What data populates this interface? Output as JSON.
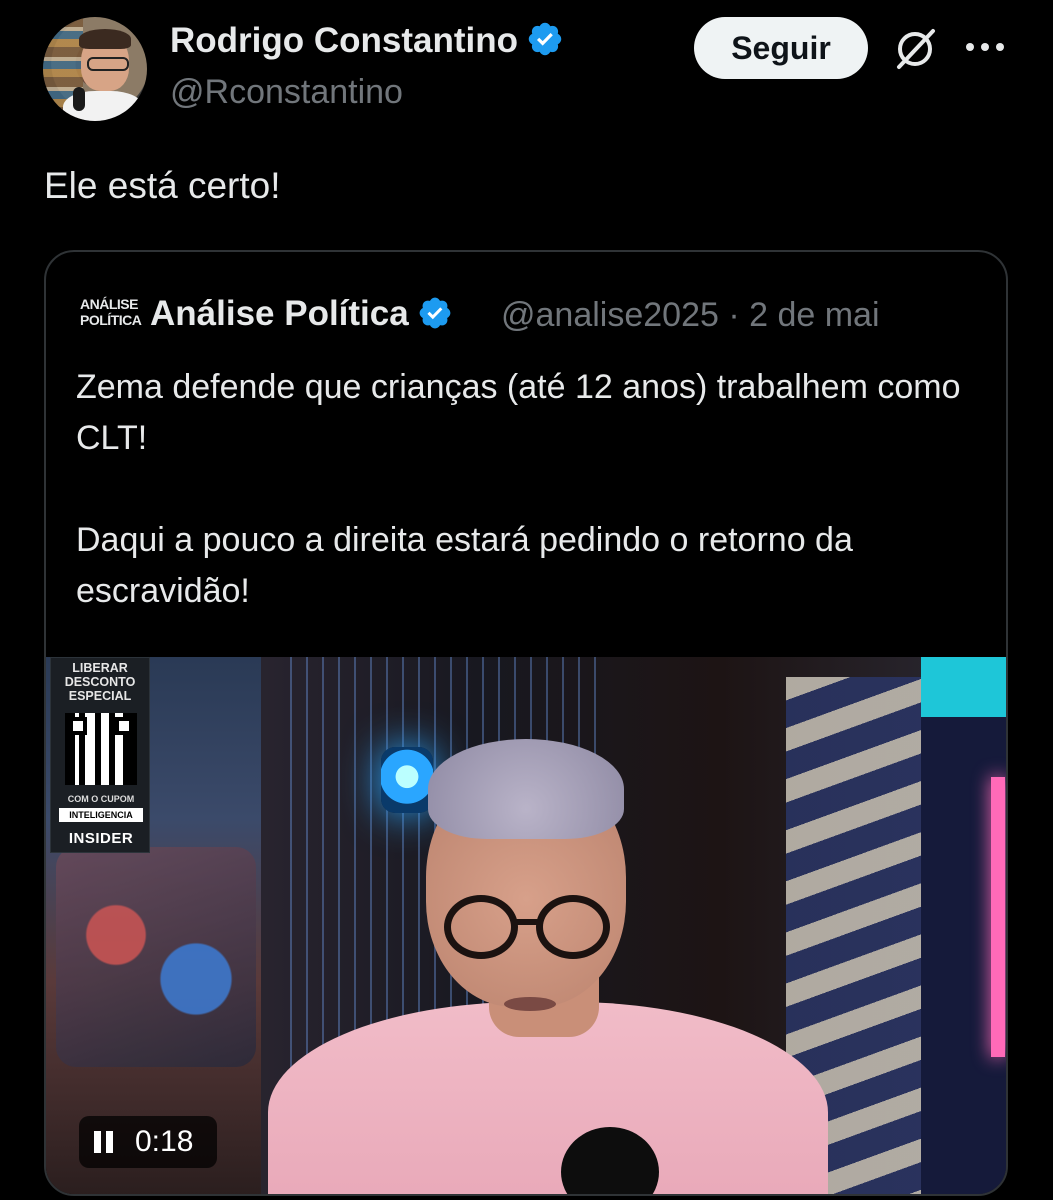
{
  "author": {
    "name": "Rodrigo Constantino",
    "handle": "@Rconstantino",
    "verified": true
  },
  "header_actions": {
    "follow_label": "Seguir",
    "grok_icon": "grok-slash-circle-icon",
    "more_icon": "more-dots-icon"
  },
  "tweet": {
    "text": "Ele está certo!"
  },
  "quoted_tweet": {
    "logo_lines": [
      "ANÁLISE",
      "POLÍTICA"
    ],
    "name": "Análise Política",
    "verified": true,
    "handle_and_date": "@analise2025 · 2 de mai",
    "paragraphs": [
      "Zema defende que crianças (até 12 anos) trabalhem como CLT!",
      "Daqui a pouco a direita estará pedindo o retorno da escravidão!"
    ],
    "video": {
      "time": "0:18",
      "state": "playing",
      "promo": {
        "title_lines": [
          "LIBERAR",
          "DESCONTO",
          "ESPECIAL"
        ],
        "coupon_label": "COM O CUPOM",
        "coupon_code": "INTELIGENCIA",
        "brand": "INSIDER"
      }
    }
  },
  "colors": {
    "background": "#000000",
    "primary_text": "#e7e9ea",
    "secondary_text": "#71767b",
    "verified_blue": "#1d9bf0",
    "border": "#2f3336",
    "follow_button_bg": "#eff3f4"
  }
}
